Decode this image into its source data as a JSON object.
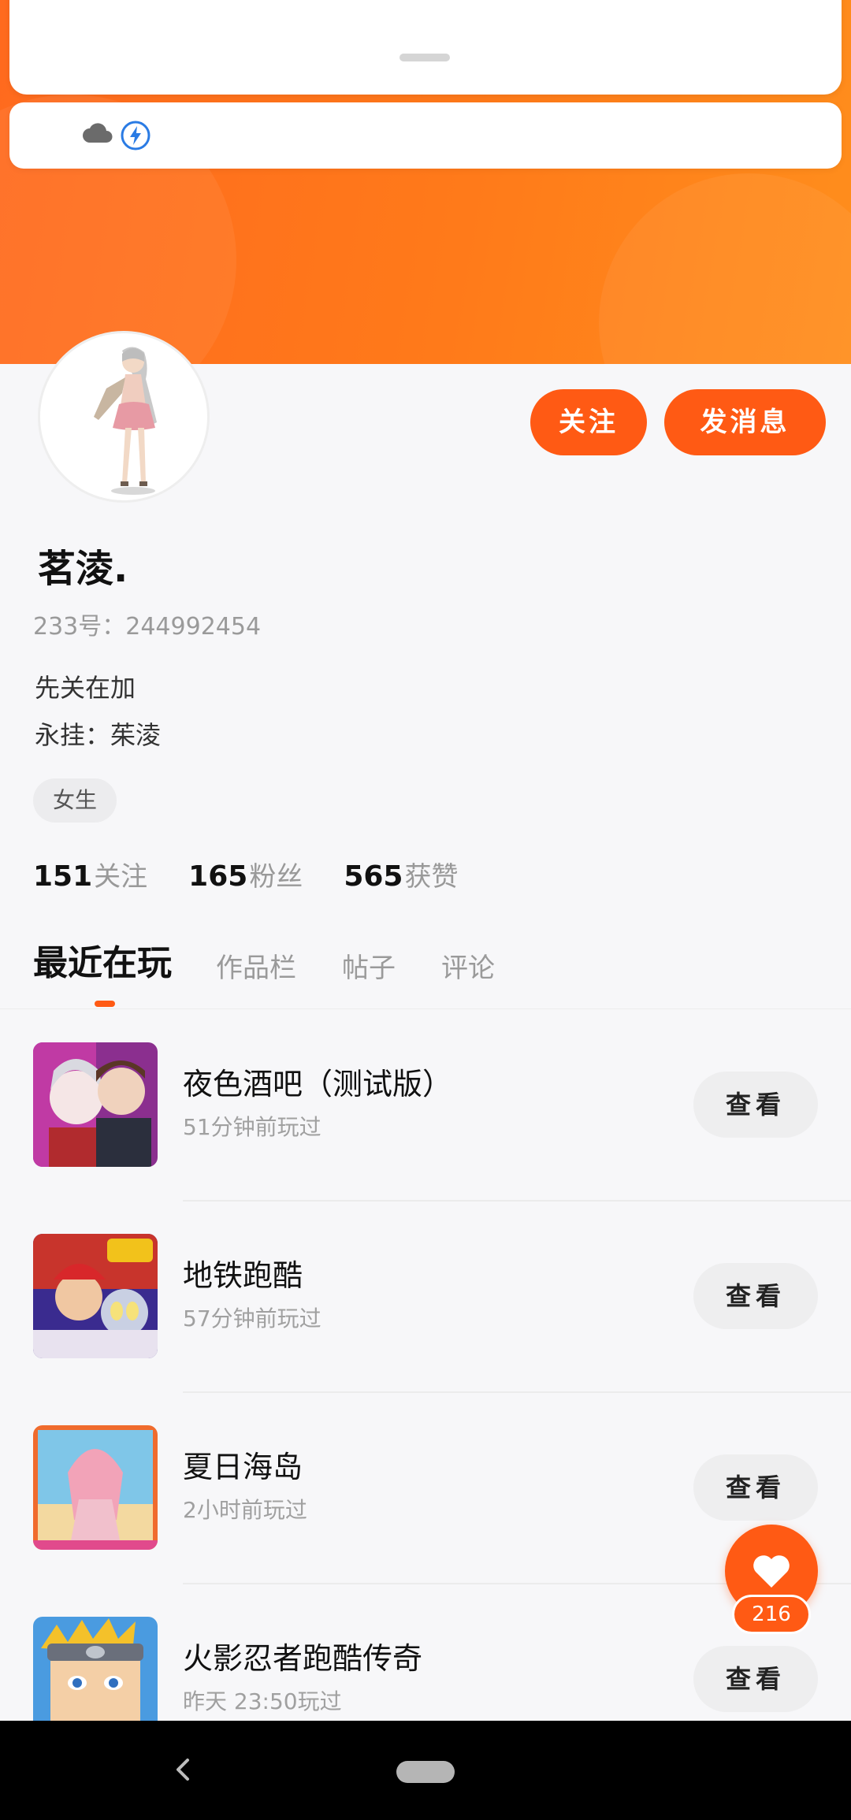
{
  "header": {
    "accent_color": "#ff6a1e",
    "status_icons": [
      "cloud-icon",
      "bolt-icon"
    ]
  },
  "profile": {
    "follow_label": "关注",
    "message_label": "发消息",
    "nickname": "茗淩.",
    "uid": "233号：244992454",
    "bio_line1": "先关在加",
    "bio_line2": "永挂：茱淩",
    "gender_tag": "女生",
    "stats": [
      {
        "num": "151",
        "label": "关注"
      },
      {
        "num": "165",
        "label": "粉丝"
      },
      {
        "num": "565",
        "label": "获赞"
      }
    ]
  },
  "tabs": [
    "最近在玩",
    "作品栏",
    "帖子",
    "评论"
  ],
  "games": [
    {
      "title": "夜色酒吧（测试版）",
      "time": "51分钟前玩过",
      "action": "查看"
    },
    {
      "title": "地铁跑酷",
      "time": "57分钟前玩过",
      "action": "查看"
    },
    {
      "title": "夏日海岛",
      "time": "2小时前玩过",
      "action": "查看"
    },
    {
      "title": "火影忍者跑酷传奇",
      "time": "昨天 23:50玩过",
      "action": "查看"
    }
  ],
  "like": {
    "count": "216"
  }
}
